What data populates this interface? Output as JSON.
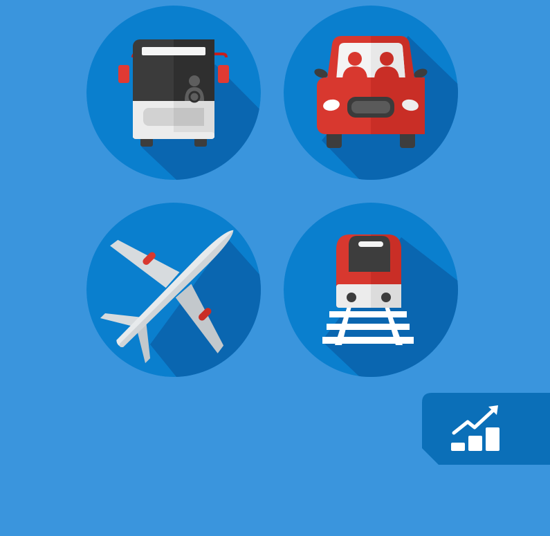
{
  "tiles": [
    {
      "icon": "bus-icon"
    },
    {
      "icon": "car-icon"
    },
    {
      "icon": "airplane-icon"
    },
    {
      "icon": "train-icon"
    }
  ],
  "badge": {
    "icon": "growth-chart-icon"
  },
  "colors": {
    "background": "#3a95dd",
    "circle": "#0a7fce",
    "shadow": "#0a66b0",
    "badge": "#0b6fb8",
    "red": "#d8382f",
    "dark": "#3d3d3d"
  }
}
